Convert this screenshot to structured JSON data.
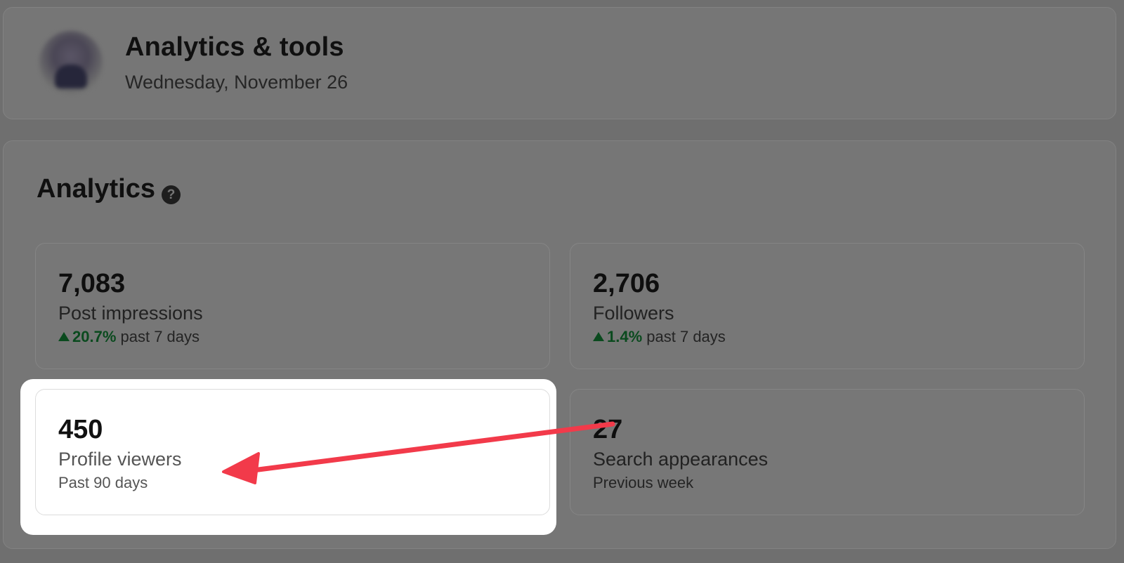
{
  "header": {
    "title": "Analytics & tools",
    "date": "Wednesday, November 26"
  },
  "analytics": {
    "title": "Analytics",
    "help_icon": "?",
    "metrics": [
      {
        "value": "7,083",
        "label": "Post impressions",
        "change": "20.7%",
        "period": "past 7 days",
        "trend": "up"
      },
      {
        "value": "2,706",
        "label": "Followers",
        "change": "1.4%",
        "period": "past 7 days",
        "trend": "up"
      },
      {
        "value": "450",
        "label": "Profile viewers",
        "period": "Past 90 days",
        "highlighted": true
      },
      {
        "value": "27",
        "label": "Search appearances",
        "period": "Previous week"
      }
    ]
  },
  "colors": {
    "trend_up": "#0a4a1e",
    "annotation_arrow": "#f23a4a",
    "highlight": "#ffffff"
  }
}
